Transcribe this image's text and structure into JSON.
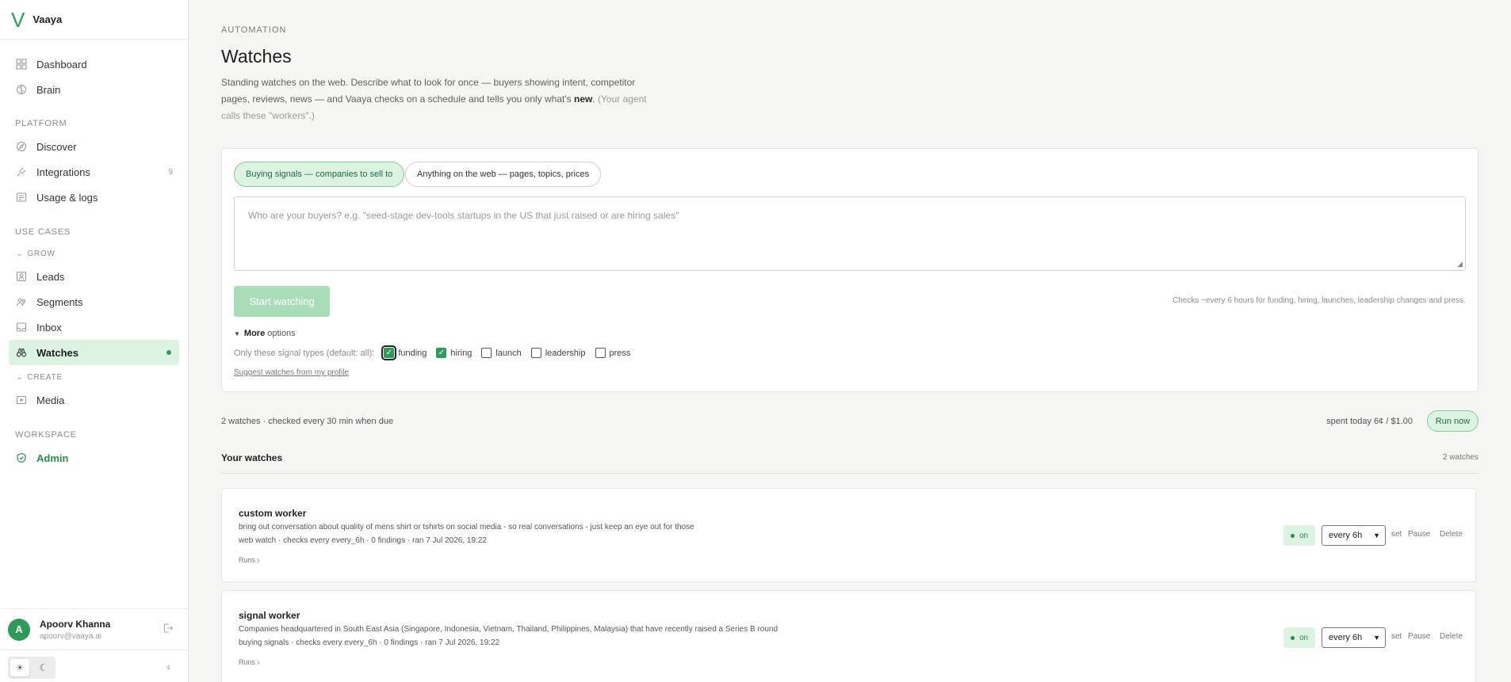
{
  "brand": {
    "logo": "V",
    "name": "Vaaya"
  },
  "nav": {
    "dashboard": "Dashboard",
    "brain": "Brain",
    "platform_label": "PLATFORM",
    "discover": "Discover",
    "integrations": "Integrations",
    "integrations_count": "9",
    "usage": "Usage & logs",
    "use_cases_label": "USE CASES",
    "grow_label": "GROW",
    "leads": "Leads",
    "segments": "Segments",
    "inbox": "Inbox",
    "watches": "Watches",
    "create_label": "CREATE",
    "media": "Media",
    "workspace_label": "WORKSPACE",
    "admin": "Admin"
  },
  "user": {
    "initial": "A",
    "name": "Apoorv Khanna",
    "email": "apoorv@vaaya.ai"
  },
  "header": {
    "eyebrow": "AUTOMATION",
    "title": "Watches",
    "intro_a": "Standing watches on the web. Describe what to look for once — buyers showing intent, competitor pages, reviews, news — and Vaaya checks on a schedule and tells you only what's ",
    "intro_bold": "new",
    "intro_b": ". ",
    "intro_muted": "(Your agent calls these \"workers\".)"
  },
  "composer": {
    "tab_signals": "Buying signals — companies to sell to",
    "tab_web": "Anything on the web — pages, topics, prices",
    "placeholder": "Who are your buyers? e.g. \"seed-stage dev-tools startups in the US that just raised or are hiring sales\"",
    "start_label": "Start watching",
    "checks_note": "Checks ~every 6 hours for funding, hiring, launches, leadership changes and press.",
    "more_bold": "More",
    "more_rest": "options",
    "filter_label": "Only these signal types (default: all):",
    "signal_types": [
      {
        "label": "funding",
        "checked": true
      },
      {
        "label": "hiring",
        "checked": true
      },
      {
        "label": "launch",
        "checked": false
      },
      {
        "label": "leadership",
        "checked": false
      },
      {
        "label": "press",
        "checked": false
      }
    ],
    "suggest": "Suggest watches from my profile"
  },
  "summary": {
    "status": "2 watches · checked every 30 min when due",
    "spent": "spent today 6¢ / $1.00",
    "run_now": "Run now"
  },
  "list": {
    "heading": "Your watches",
    "count": "2 watches"
  },
  "watches": [
    {
      "name": "custom worker",
      "description": "bring out conversation about quality of mens shirt or tshirts on social media - so real conversations - just keep an eye out for those",
      "meta": "web watch · checks every every_6h · 0 findings · ran 7 Jul 2026, 19:22",
      "runs": "Runs ›",
      "status": "on",
      "schedule": "every 6h",
      "set": "set",
      "pause": "Pause",
      "delete": "Delete"
    },
    {
      "name": "signal worker",
      "description": "Companies headquartered in South East Asia (Singapore, Indonesia, Vietnam, Thailand, Philippines, Malaysia) that have recently raised a Series B round",
      "meta": "buying signals · checks every every_6h · 0 findings · ran 7 Jul 2026, 19:22",
      "runs": "Runs ›",
      "status": "on",
      "schedule": "every 6h",
      "set": "set",
      "pause": "Pause",
      "delete": "Delete"
    }
  ],
  "colors": {
    "accent": "#2f9a5a",
    "accent_bg": "#dcf3e2",
    "page_bg": "#f5f5f4"
  }
}
